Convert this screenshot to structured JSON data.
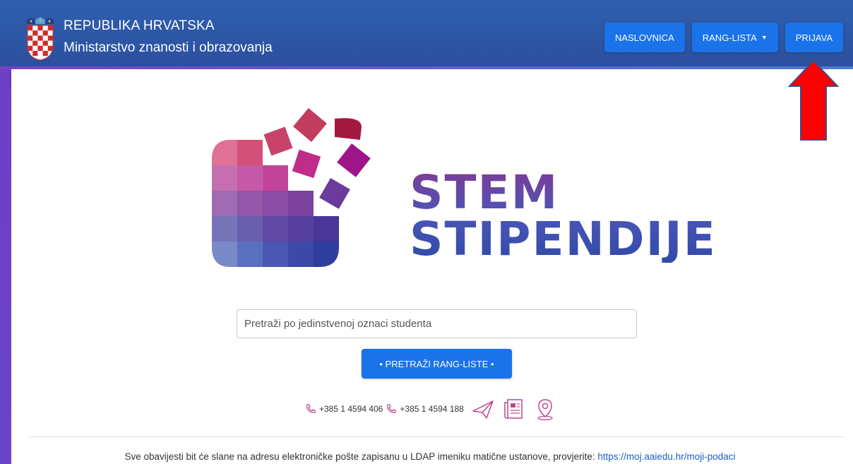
{
  "header": {
    "title": "REPUBLIKA HRVATSKA",
    "subtitle": "Ministarstvo znanosti i obrazovanja",
    "nav": {
      "home": "NASLOVNICA",
      "ranking": "RANG-LISTA",
      "login": "PRIJAVA"
    }
  },
  "logo": {
    "line1": "STEM",
    "line2": "STIPENDIJE"
  },
  "search": {
    "placeholder": "Pretraži po jedinstvenoj oznaci studenta",
    "button": "• PRETRAŽI RANG-LISTE •"
  },
  "contacts": {
    "phone1": "+385 1 4594 406",
    "phone2": "+385 1 4594 188",
    "icons": [
      "phone-icon",
      "paper-plane-icon",
      "newspaper-icon",
      "location-pin-icon"
    ]
  },
  "footer": {
    "text": "Sve obavijesti bit će slane na adresu elektroničke pošte zapisanu u LDAP imeniku matične ustanove, provjerite: ",
    "link": "https://moj.aaiedu.hr/moji-podaci"
  },
  "annotation": {
    "arrow_color": "#ff0000"
  },
  "colors": {
    "header": "#2f5fb1",
    "button": "#1a73e8",
    "accent": "#6c3fc7"
  }
}
